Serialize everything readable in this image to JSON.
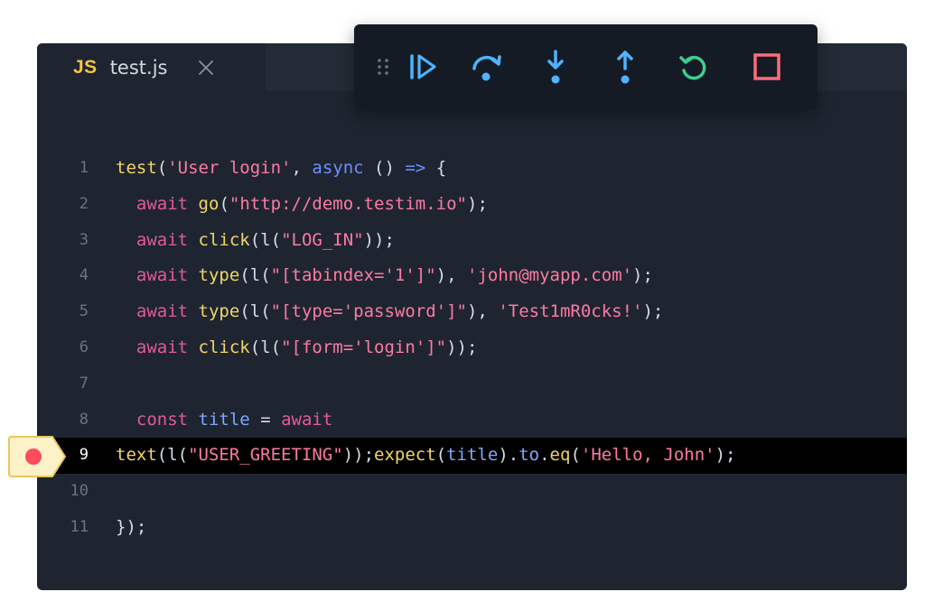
{
  "tab": {
    "lang": "JS",
    "filename": "test.js"
  },
  "toolbar": {
    "buttons": [
      {
        "icon": "drag-handle-icon"
      },
      {
        "icon": "resume-icon"
      },
      {
        "icon": "step-over-icon"
      },
      {
        "icon": "step-into-icon"
      },
      {
        "icon": "step-out-icon"
      },
      {
        "icon": "restart-icon"
      },
      {
        "icon": "stop-icon"
      }
    ]
  },
  "code": {
    "active_line": 9,
    "lines": [
      {
        "n": "1",
        "tokens": [
          [
            "fn",
            "test"
          ],
          [
            "pl",
            "("
          ],
          [
            "str",
            "'User login'"
          ],
          [
            "pl",
            ", "
          ],
          [
            "kw2",
            "async"
          ],
          [
            "pl",
            " () "
          ],
          [
            "kw2",
            "=>"
          ],
          [
            "pl",
            " {"
          ]
        ]
      },
      {
        "n": "2",
        "tokens": [
          [
            "pl",
            "  "
          ],
          [
            "kw",
            "await"
          ],
          [
            "pl",
            " "
          ],
          [
            "fn",
            "go"
          ],
          [
            "pl",
            "("
          ],
          [
            "str",
            "\"http://demo.testim.io\""
          ],
          [
            "pl",
            ");"
          ]
        ]
      },
      {
        "n": "3",
        "tokens": [
          [
            "pl",
            "  "
          ],
          [
            "kw",
            "await"
          ],
          [
            "pl",
            " "
          ],
          [
            "fn",
            "click"
          ],
          [
            "pl",
            "(l("
          ],
          [
            "str",
            "\"LOG_IN\""
          ],
          [
            "pl",
            "));"
          ]
        ]
      },
      {
        "n": "4",
        "tokens": [
          [
            "pl",
            "  "
          ],
          [
            "kw",
            "await"
          ],
          [
            "pl",
            " "
          ],
          [
            "fn",
            "type"
          ],
          [
            "pl",
            "(l("
          ],
          [
            "str",
            "\"[tabindex='1']\""
          ],
          [
            "pl",
            "), "
          ],
          [
            "str",
            "'john@myapp.com'"
          ],
          [
            "pl",
            ");"
          ]
        ]
      },
      {
        "n": "5",
        "tokens": [
          [
            "pl",
            "  "
          ],
          [
            "kw",
            "await"
          ],
          [
            "pl",
            " "
          ],
          [
            "fn",
            "type"
          ],
          [
            "pl",
            "(l("
          ],
          [
            "str",
            "\"[type='password']\""
          ],
          [
            "pl",
            "), "
          ],
          [
            "str",
            "'Test1mR0cks!'"
          ],
          [
            "pl",
            ");"
          ]
        ]
      },
      {
        "n": "6",
        "tokens": [
          [
            "pl",
            "  "
          ],
          [
            "kw",
            "await"
          ],
          [
            "pl",
            " "
          ],
          [
            "fn",
            "click"
          ],
          [
            "pl",
            "(l("
          ],
          [
            "str",
            "\"[form='login']\""
          ],
          [
            "pl",
            "));"
          ]
        ]
      },
      {
        "n": "7",
        "tokens": []
      },
      {
        "n": "8",
        "tokens": [
          [
            "pl",
            "  "
          ],
          [
            "kw",
            "const"
          ],
          [
            "pl",
            " "
          ],
          [
            "var",
            "title"
          ],
          [
            "pl",
            " = "
          ],
          [
            "kw",
            "await"
          ]
        ]
      },
      {
        "n": "9",
        "tokens": [
          [
            "fn",
            "text"
          ],
          [
            "pl",
            "(l("
          ],
          [
            "str",
            "\"USER_GREETING\""
          ],
          [
            "pl",
            "));"
          ],
          [
            "fn",
            "expect"
          ],
          [
            "pl",
            "("
          ],
          [
            "var",
            "title"
          ],
          [
            "pl",
            ")."
          ],
          [
            "var",
            "to"
          ],
          [
            "pl",
            "."
          ],
          [
            "fn",
            "eq"
          ],
          [
            "pl",
            "("
          ],
          [
            "str",
            "'Hello, John'"
          ],
          [
            "pl",
            ");"
          ]
        ]
      },
      {
        "n": "10",
        "tokens": []
      },
      {
        "n": "11",
        "tokens": [
          [
            "pl",
            "});"
          ]
        ]
      }
    ]
  },
  "colors": {
    "editor_bg": "#1e2530",
    "toolbar_bg": "#151b24",
    "debug_blue": "#4fb3ff",
    "restart_green": "#3ecf8e",
    "stop_red": "#ff6b7a",
    "breakpoint_red": "#ff4b5c",
    "breakpoint_marker": "#fdf1c8"
  }
}
